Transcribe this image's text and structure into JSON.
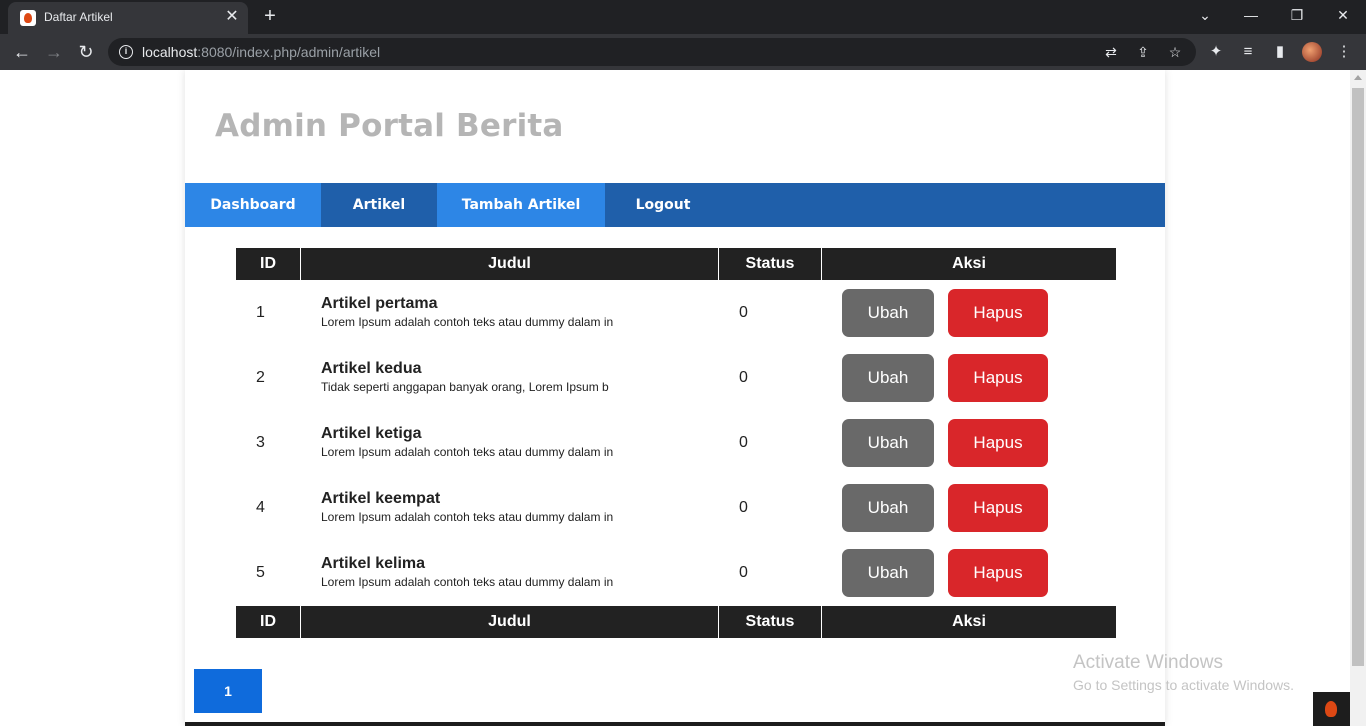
{
  "browser": {
    "tab_title": "Daftar Artikel",
    "tab_close": "✕",
    "new_tab": "+",
    "url_host": "localhost",
    "url_rest": ":8080/index.php/admin/artikel"
  },
  "site": {
    "title": "Admin Portal Berita"
  },
  "nav": {
    "items": [
      {
        "label": "Dashboard",
        "color": "#2d86e6"
      },
      {
        "label": "Artikel",
        "color": "#1f5faa"
      },
      {
        "label": "Tambah Artikel",
        "color": "#2d86e6"
      },
      {
        "label": "Logout",
        "color": "#1f5faa"
      }
    ]
  },
  "table": {
    "headers": [
      "ID",
      "Judul",
      "Status",
      "Aksi"
    ],
    "edit_label": "Ubah",
    "delete_label": "Hapus",
    "rows": [
      {
        "id": "1",
        "title": "Artikel pertama",
        "excerpt": "Lorem Ipsum adalah contoh teks atau dummy dalam in",
        "status": "0"
      },
      {
        "id": "2",
        "title": "Artikel kedua",
        "excerpt": "Tidak seperti anggapan banyak orang, Lorem Ipsum b",
        "status": "0"
      },
      {
        "id": "3",
        "title": "Artikel ketiga",
        "excerpt": "Lorem Ipsum adalah contoh teks atau dummy dalam in",
        "status": "0"
      },
      {
        "id": "4",
        "title": "Artikel keempat",
        "excerpt": "Lorem Ipsum adalah contoh teks atau dummy dalam in",
        "status": "0"
      },
      {
        "id": "5",
        "title": "Artikel kelima",
        "excerpt": "Lorem Ipsum adalah contoh teks atau dummy dalam in",
        "status": "0"
      }
    ]
  },
  "pagination": {
    "current": "1"
  },
  "watermark": {
    "title": "Activate Windows",
    "subtitle": "Go to Settings to activate Windows."
  },
  "colors": {
    "nav_bar": "#1f5faa",
    "edit_button": "#696969",
    "delete_button": "#d9262a",
    "pager": "#0f6bdc"
  }
}
